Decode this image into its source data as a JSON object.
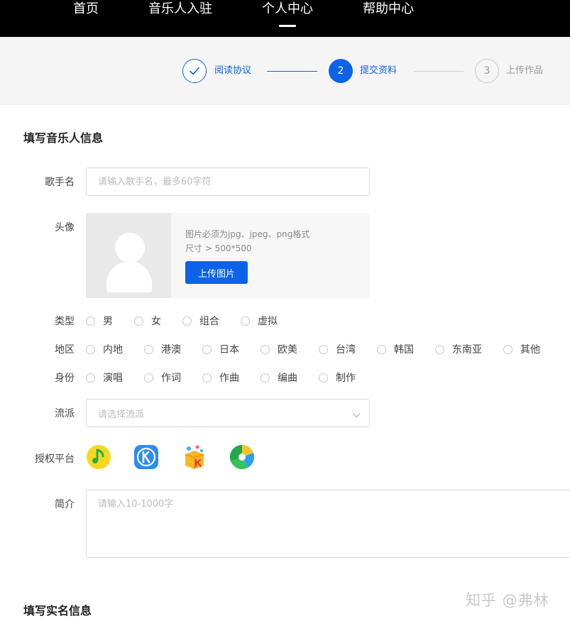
{
  "nav": {
    "items": [
      {
        "label": "首页"
      },
      {
        "label": "音乐人入驻"
      },
      {
        "label": "个人中心"
      },
      {
        "label": "帮助中心"
      }
    ],
    "active_index": 2
  },
  "steps": [
    {
      "number": "",
      "label": "阅读协议",
      "state": "done"
    },
    {
      "number": "2",
      "label": "提交资料",
      "state": "current"
    },
    {
      "number": "3",
      "label": "上传作品",
      "state": "todo"
    }
  ],
  "section_artist": {
    "title": "填写音乐人信息"
  },
  "section_realname": {
    "title": "填写实名信息"
  },
  "fields": {
    "name": {
      "label": "歌手名",
      "placeholder": "请输入歌手名，最多60字符",
      "value": ""
    },
    "avatar": {
      "label": "头像",
      "hint_format": "图片必须为jpg、jpeg、png格式",
      "hint_size": "尺寸 > 500*500",
      "upload_label": "上传图片"
    },
    "type": {
      "label": "类型",
      "options": [
        "男",
        "女",
        "组合",
        "虚拟"
      ]
    },
    "region": {
      "label": "地区",
      "options": [
        "内地",
        "港澳",
        "日本",
        "欧美",
        "台湾",
        "韩国",
        "东南亚",
        "其他"
      ]
    },
    "identity": {
      "label": "身份",
      "options": [
        "演唱",
        "作词",
        "作曲",
        "编曲",
        "制作"
      ]
    },
    "genre": {
      "label": "流派",
      "placeholder": "请选择流派"
    },
    "platforms": {
      "label": "授权平台",
      "items": [
        {
          "icon": "qq-music-icon",
          "color": "#f6d823"
        },
        {
          "icon": "kugou-icon",
          "color": "#2d8cf0"
        },
        {
          "icon": "kuwo-k-song-icon",
          "color": "#ffb623"
        },
        {
          "icon": "kuwo-music-icon",
          "color": "#2b9ef5"
        }
      ]
    },
    "intro": {
      "label": "简介",
      "placeholder": "请输入10-1000字",
      "value": ""
    }
  },
  "watermark": "知乎 @弗林",
  "colors": {
    "accent": "#0c62e8",
    "nav_bg": "#000000",
    "steps_bg": "#f5f5f5"
  }
}
